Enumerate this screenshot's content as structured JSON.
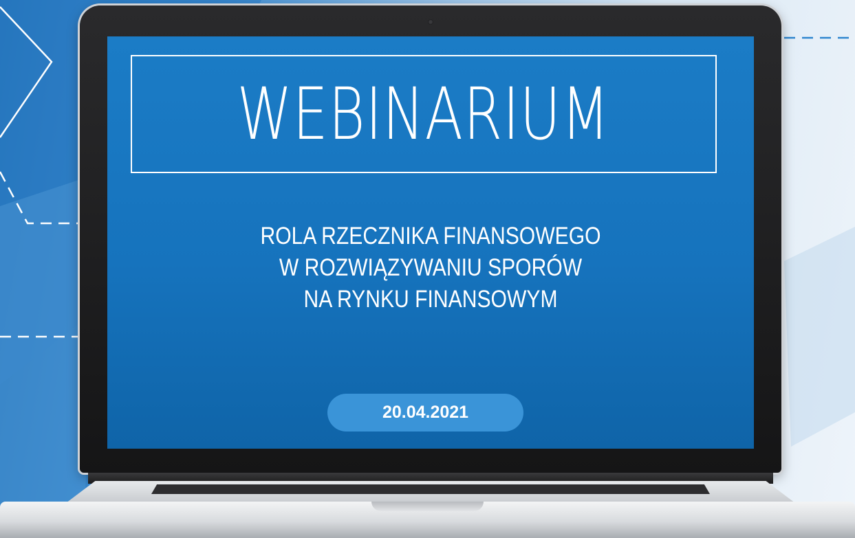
{
  "title": "WEBINARIUM",
  "subtitle_lines": [
    "ROLA RZECZNIKA FINANSOWEGO",
    "W ROZWIĄZYWANIU SPORÓW",
    "NA RYNKU FINANSOWYM"
  ],
  "date": "20.04.2021",
  "colors": {
    "screen_blue": "#1673bd",
    "date_pill": "#3a94d8",
    "text": "#ffffff"
  }
}
